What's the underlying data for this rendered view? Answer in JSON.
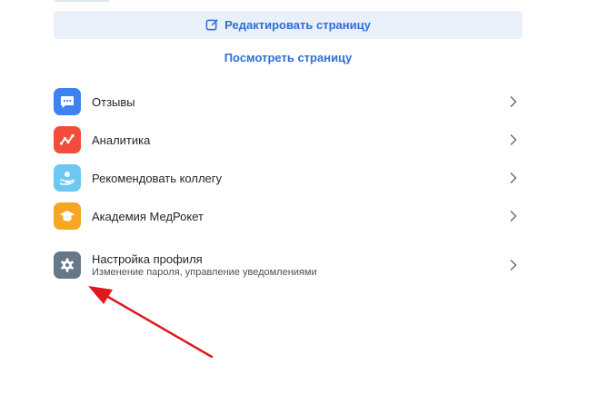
{
  "actions": {
    "edit_label": "Редактировать страницу",
    "view_label": "Посмотреть страницу"
  },
  "menu": {
    "items": [
      {
        "label": "Отзывы",
        "icon": "chat-bubble-icon",
        "color": "#3d82f0"
      },
      {
        "label": "Аналитика",
        "icon": "analytics-icon",
        "color": "#f24c3d"
      },
      {
        "label": "Рекомендовать коллегу",
        "icon": "recommend-icon",
        "color": "#6cc7f2"
      },
      {
        "label": "Академия МедРокет",
        "icon": "graduation-cap-icon",
        "color": "#f5a623"
      },
      {
        "label": "Настройка профиля",
        "sublabel": "Изменение пароля, управление уведомлениями",
        "icon": "gear-icon",
        "color": "#667788"
      }
    ]
  },
  "annotation": {
    "color": "#e0181e"
  }
}
